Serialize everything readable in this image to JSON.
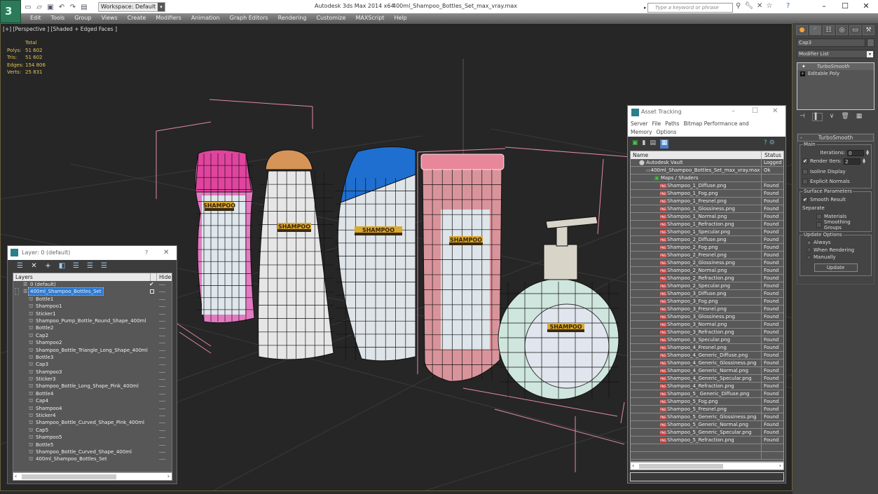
{
  "titlebar": {
    "app_title": "Autodesk 3ds Max  2014 x64",
    "file_title": "400ml_Shampoo_Bottles_Set_max_vray.max",
    "workspace": "Workspace: Default",
    "search_placeholder": "Type a keyword or phrase",
    "logo": "3",
    "window_buttons": {
      "minimize": "–",
      "maximize": "☐",
      "close": "✕"
    }
  },
  "menubar": [
    "Edit",
    "Tools",
    "Group",
    "Views",
    "Create",
    "Modifiers",
    "Animation",
    "Graph Editors",
    "Rendering",
    "Customize",
    "MAXScript",
    "Help"
  ],
  "viewport": {
    "label": "[+] [Perspective ] [Shaded + Edged Faces ]",
    "stats": {
      "header": "Total",
      "rows": [
        {
          "k": "Polys:",
          "v": "51 602"
        },
        {
          "k": "Tris:",
          "v": "51 602"
        },
        {
          "k": "Edges:",
          "v": "154 806"
        },
        {
          "k": "Verts:",
          "v": "25 831"
        }
      ]
    },
    "bottles": [
      {
        "name": "pink-curved",
        "cap_color": "#e0449e",
        "body_color": "#e47ac2",
        "label": "SHAMPOO"
      },
      {
        "name": "white-orange-cap",
        "cap_color": "#d79458",
        "body_color": "#e6e6e6",
        "label": "SHAMPOO"
      },
      {
        "name": "white-blue-cap",
        "cap_color": "#1f6fd0",
        "body_color": "#dfe4e8",
        "label": "SHAMPOO"
      },
      {
        "name": "pink-long",
        "cap_color": "#e8879a",
        "body_color": "#d9949b",
        "label": "SHAMPOO"
      },
      {
        "name": "pump-round",
        "cap_color": "#d8d4c8",
        "body_color": "#cfe6de",
        "label": "SHAMPOO"
      }
    ],
    "selection_color": "#e38aa8"
  },
  "command_panel": {
    "tabs": [
      "create",
      "modify",
      "hierarchy",
      "motion",
      "display",
      "utilities"
    ],
    "object_name": "Cap3",
    "modifier_list": "Modifier List",
    "stack": [
      {
        "label": "TurboSmooth",
        "selected": true
      },
      {
        "label": "Editable Poly",
        "selected": false
      }
    ],
    "rollout": {
      "title": "TurboSmooth",
      "main_group": "Main",
      "iterations_label": "Iterations:",
      "iterations_value": "0",
      "render_iters_label": "Render Iters:",
      "render_iters_value": "2",
      "render_iters_checked": true,
      "isoline_label": "Isoline Display",
      "explicit_label": "Explicit Normals",
      "surface_group": "Surface Parameters",
      "smooth_result_label": "Smooth Result",
      "separate_label": "Separate",
      "materials_label": "Materials",
      "smoothing_groups_label": "Smoothing Groups",
      "update_group": "Update Options",
      "always_label": "Always",
      "when_rendering_label": "When Rendering",
      "manually_label": "Manually",
      "update_button": "Update"
    }
  },
  "layer_dialog": {
    "title": "Layer: 0 (default)",
    "help": "?",
    "close": "✕",
    "col_layers": "Layers",
    "col_hide": "Hide",
    "rows": [
      {
        "label": "0 (default)",
        "level": 1,
        "type": "layer",
        "current": true
      },
      {
        "label": "400ml_Shampoo_Bottles_Set",
        "level": 1,
        "type": "layer",
        "selected": true
      },
      {
        "label": "Bottle1",
        "level": 2,
        "type": "object"
      },
      {
        "label": "Shampoo1",
        "level": 2,
        "type": "object"
      },
      {
        "label": "Sticker1",
        "level": 2,
        "type": "object"
      },
      {
        "label": "Shampoo_Pump_Bottle_Round_Shape_400ml",
        "level": 2,
        "type": "object"
      },
      {
        "label": "Bottle2",
        "level": 2,
        "type": "object"
      },
      {
        "label": "Cap2",
        "level": 2,
        "type": "object"
      },
      {
        "label": "Shampoo2",
        "level": 2,
        "type": "object"
      },
      {
        "label": "Shampoo_Bottle_Triangle_Long_Shape_400ml",
        "level": 2,
        "type": "object"
      },
      {
        "label": "Bottle3",
        "level": 2,
        "type": "object"
      },
      {
        "label": "Cap3",
        "level": 2,
        "type": "object"
      },
      {
        "label": "Shampoo3",
        "level": 2,
        "type": "object"
      },
      {
        "label": "Sticker3",
        "level": 2,
        "type": "object"
      },
      {
        "label": "Shampoo_Bottle_Long_Shape_Pink_400ml",
        "level": 2,
        "type": "object"
      },
      {
        "label": "Bottle4",
        "level": 2,
        "type": "object"
      },
      {
        "label": "Cap4",
        "level": 2,
        "type": "object"
      },
      {
        "label": "Shampoo4",
        "level": 2,
        "type": "object"
      },
      {
        "label": "Sticker4",
        "level": 2,
        "type": "object"
      },
      {
        "label": "Shampoo_Bottle_Curved_Shape_Pink_400ml",
        "level": 2,
        "type": "object"
      },
      {
        "label": "Cap5",
        "level": 2,
        "type": "object"
      },
      {
        "label": "Shampoo5",
        "level": 2,
        "type": "object"
      },
      {
        "label": "Bottle5",
        "level": 2,
        "type": "object"
      },
      {
        "label": "Shampoo_Bottle_Curved_Shape_400ml",
        "level": 2,
        "type": "object"
      },
      {
        "label": "400ml_Shampoo_Bottles_Set",
        "level": 2,
        "type": "object"
      }
    ]
  },
  "asset_tracking": {
    "title": "Asset Tracking",
    "menu": [
      "Server",
      "File",
      "Paths",
      "Bitmap Performance and Memory",
      "Options"
    ],
    "col_name": "Name",
    "col_status": "Status",
    "rows": [
      {
        "name": "Autodesk Vault",
        "status": "Logged",
        "level": 0,
        "icon": "vault"
      },
      {
        "name": "400ml_Shampoo_Bottles_Set_max_vray.max",
        "status": "Ok",
        "level": 1,
        "icon": "max"
      },
      {
        "name": "Maps / Shaders",
        "status": "",
        "level": 2,
        "icon": "maps"
      },
      {
        "name": "Shampoo_1_Diffuse.png",
        "status": "Found",
        "level": 3,
        "icon": "png"
      },
      {
        "name": "Shampoo_1_Fog.png",
        "status": "Found",
        "level": 3,
        "icon": "png"
      },
      {
        "name": "Shampoo_1_Fresnel.png",
        "status": "Found",
        "level": 3,
        "icon": "png"
      },
      {
        "name": "Shampoo_1_Glossiness.png",
        "status": "Found",
        "level": 3,
        "icon": "png"
      },
      {
        "name": "Shampoo_1_Normal.png",
        "status": "Found",
        "level": 3,
        "icon": "png"
      },
      {
        "name": "Shampoo_1_Refraction.png",
        "status": "Found",
        "level": 3,
        "icon": "png"
      },
      {
        "name": "Shampoo_1_Specular.png",
        "status": "Found",
        "level": 3,
        "icon": "png"
      },
      {
        "name": "Shampoo_2_Diffuse.png",
        "status": "Found",
        "level": 3,
        "icon": "png"
      },
      {
        "name": "Shampoo_2_Fog.png",
        "status": "Found",
        "level": 3,
        "icon": "png"
      },
      {
        "name": "Shampoo_2_Fresnel.png",
        "status": "Found",
        "level": 3,
        "icon": "png"
      },
      {
        "name": "Shampoo_2_Glossiness.png",
        "status": "Found",
        "level": 3,
        "icon": "png"
      },
      {
        "name": "Shampoo_2_Normal.png",
        "status": "Found",
        "level": 3,
        "icon": "png"
      },
      {
        "name": "Shampoo_2_Refraction.png",
        "status": "Found",
        "level": 3,
        "icon": "png"
      },
      {
        "name": "Shampoo_2_Specular.png",
        "status": "Found",
        "level": 3,
        "icon": "png"
      },
      {
        "name": "Shampoo_3_Diffuse.png",
        "status": "Found",
        "level": 3,
        "icon": "png"
      },
      {
        "name": "Shampoo_3_Fog.png",
        "status": "Found",
        "level": 3,
        "icon": "png"
      },
      {
        "name": "Shampoo_3_Fresnel.png",
        "status": "Found",
        "level": 3,
        "icon": "png"
      },
      {
        "name": "Shampoo_3_Glossiness.png",
        "status": "Found",
        "level": 3,
        "icon": "png"
      },
      {
        "name": "Shampoo_3_Normal.png",
        "status": "Found",
        "level": 3,
        "icon": "png"
      },
      {
        "name": "Shampoo_3_Refraction.png",
        "status": "Found",
        "level": 3,
        "icon": "png"
      },
      {
        "name": "Shampoo_3_Specular.png",
        "status": "Found",
        "level": 3,
        "icon": "png"
      },
      {
        "name": "Shampoo_4_Fresnel.png",
        "status": "Found",
        "level": 3,
        "icon": "png"
      },
      {
        "name": "Shampoo_4_Generic_Diffuse.png",
        "status": "Found",
        "level": 3,
        "icon": "png"
      },
      {
        "name": "Shampoo_4_Generic_Glossiness.png",
        "status": "Found",
        "level": 3,
        "icon": "png"
      },
      {
        "name": "Shampoo_4_Generic_Normal.png",
        "status": "Found",
        "level": 3,
        "icon": "png"
      },
      {
        "name": "Shampoo_4_Generic_Specular.png",
        "status": "Found",
        "level": 3,
        "icon": "png"
      },
      {
        "name": "Shampoo_4_Refraction.png",
        "status": "Found",
        "level": 3,
        "icon": "png"
      },
      {
        "name": "Shampoo_5_ Generic_Diffuse.png",
        "status": "Found",
        "level": 3,
        "icon": "png"
      },
      {
        "name": "Shampoo_5_Fog.png",
        "status": "Found",
        "level": 3,
        "icon": "png"
      },
      {
        "name": "Shampoo_5_Fresnel.png",
        "status": "Found",
        "level": 3,
        "icon": "png"
      },
      {
        "name": "Shampoo_5_Generic_Glossiness.png",
        "status": "Found",
        "level": 3,
        "icon": "png"
      },
      {
        "name": "Shampoo_5_Generic_Normal.png",
        "status": "Found",
        "level": 3,
        "icon": "png"
      },
      {
        "name": "Shampoo_5_Generic_Specular.png",
        "status": "Found",
        "level": 3,
        "icon": "png"
      },
      {
        "name": "Shampoo_5_Refraction.png",
        "status": "Found",
        "level": 3,
        "icon": "png"
      }
    ]
  }
}
